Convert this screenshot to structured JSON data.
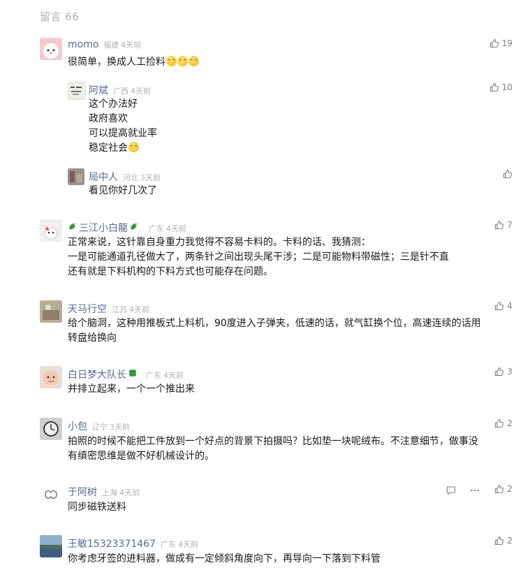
{
  "header": {
    "title": "留言 66"
  },
  "comments": [
    {
      "name": "momo",
      "location": "福建",
      "time": "4天前",
      "likes": "19",
      "lines": [
        "很简单，换成人工捡料"
      ]
    },
    {
      "name": "阿斌",
      "location": "广西",
      "time": "4天前",
      "likes": "10",
      "lines": [
        "这个办法好",
        "政府喜欢",
        "可以提高就业率",
        "稳定社会"
      ]
    },
    {
      "name": "局中人",
      "location": "河北",
      "time": "3天前",
      "likes": "",
      "lines": [
        "看见你好几次了"
      ]
    },
    {
      "name": "三江小白龍",
      "location": "广东",
      "time": "4天前",
      "likes": "7",
      "lines": [
        "正常来说，这针靠自身重力我觉得不容易卡料的。卡料的话、我猜测：",
        "一是可能通道孔径做大了，两条针之间出现头尾干涉；二是可能物料带磁性；三是针不直",
        "还有就是下料机构的下料方式也可能存在问题。"
      ]
    },
    {
      "name": "天马行空",
      "location": "江苏",
      "time": "4天前",
      "likes": "4",
      "lines": [
        "给个脑洞，这种用推板式上料机，90度进入子弹夹，低速的话，就气缸换个位，高速连续的话用",
        "转盘给换向"
      ]
    },
    {
      "name": "白日梦大队长",
      "location": "广东",
      "time": "4天前",
      "likes": "3",
      "lines": [
        "并排立起来，一个一个推出来"
      ]
    },
    {
      "name": "小包",
      "location": "辽宁",
      "time": "3天前",
      "likes": "2",
      "lines": [
        "拍照的时候不能把工件放到一个好点的背景下拍摄吗？比如垫一块呢绒布。不注意细节，做事没",
        "有缜密思维是做不好机械设计的。"
      ]
    },
    {
      "name": "于阿树",
      "location": "上海",
      "time": "4天前",
      "likes": "2",
      "lines": [
        "同步磁铁送料"
      ]
    },
    {
      "name": "王敏15323371467",
      "location": "广东",
      "time": "4天前",
      "likes": "2",
      "lines": [
        "你考虑牙签的进料器，做成有一定倾斜角度向下，再导向一下落到下料管"
      ]
    }
  ],
  "icons": {
    "like": "thumbs-up-icon",
    "reply": "comment-icon",
    "more": "more-dots-icon",
    "emoji_grin": "grinning-squint-emoji",
    "emoji_heart_eyes": "heart-eyes-emoji",
    "leaf": "clover-leaf-emoji",
    "dragon": "dragon-emoji"
  },
  "colors": {
    "nickname": "#576b95",
    "meta": "#b2b2b2",
    "text": "#1a1a1a",
    "icon": "#7f7f7f"
  }
}
